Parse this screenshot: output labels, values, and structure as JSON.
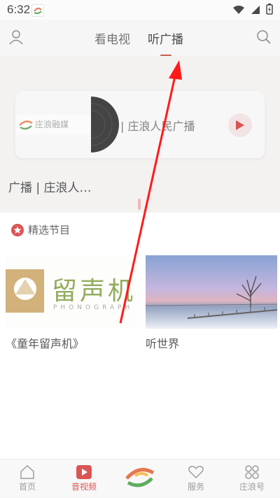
{
  "status_bar": {
    "time": "6:32"
  },
  "header": {
    "tabs": [
      {
        "label": "看电视"
      },
      {
        "label": "听广播"
      }
    ],
    "active_tab": "听广播"
  },
  "radio": {
    "card_title": "| 庄浪人民广播",
    "logo_text": "庄浪融媒",
    "station_name": "广播 | 庄浪人…"
  },
  "featured": {
    "section_title": "精选节目",
    "programs": [
      {
        "title": "《童年留声机》",
        "thumb_text": "留声机",
        "thumb_sub": "PHONOGRAPH"
      },
      {
        "title": "听世界"
      }
    ]
  },
  "bottom_nav": {
    "items": [
      {
        "label": "首页",
        "icon": "home-icon"
      },
      {
        "label": "音视频",
        "icon": "video-play-icon"
      },
      {
        "label": "",
        "icon": "center-logo-icon"
      },
      {
        "label": "服务",
        "icon": "heart-icon"
      },
      {
        "label": "庄浪号",
        "icon": "grid-icon"
      }
    ],
    "active": "音视频"
  },
  "colors": {
    "accent": "#d32f2f",
    "arrow": "#ff1a1a"
  }
}
